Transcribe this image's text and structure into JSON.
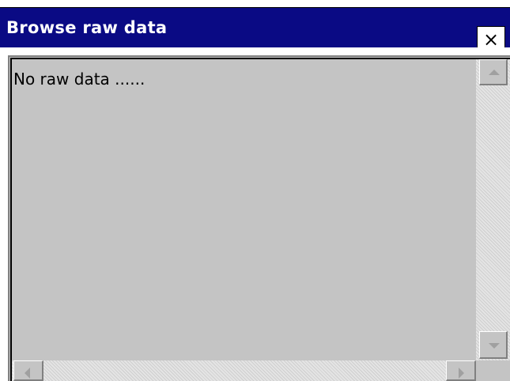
{
  "window": {
    "title": "Browse raw data",
    "close_label": "×"
  },
  "content": {
    "text": "No raw data ......"
  },
  "icons": {
    "close": "close-icon",
    "scroll_up": "chevron-up-icon",
    "scroll_down": "chevron-down-icon",
    "scroll_left": "chevron-left-icon",
    "scroll_right": "chevron-right-icon"
  },
  "colors": {
    "titlebar": "#0a0a84",
    "title_text": "#ffffff",
    "panel": "#c4c4c4"
  }
}
